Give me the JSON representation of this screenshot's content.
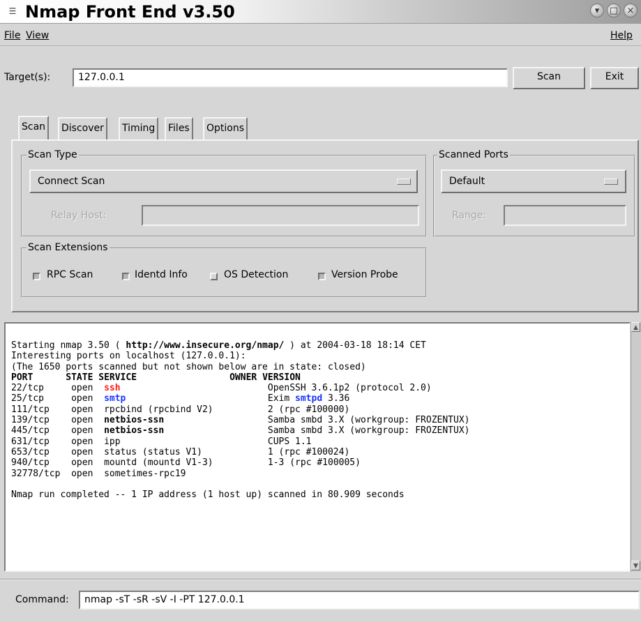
{
  "window": {
    "title": "Nmap Front End v3.50",
    "icon": "window-menu-icon",
    "controls": [
      "minimize-icon",
      "maximize-icon",
      "close-icon"
    ]
  },
  "menubar": {
    "file": "File",
    "view": "View",
    "help": "Help"
  },
  "target": {
    "label": "Target(s):",
    "value": "127.0.0.1",
    "scan_button": "Scan",
    "exit_button": "Exit"
  },
  "tabs": [
    "Scan",
    "Discover",
    "Timing",
    "Files",
    "Options"
  ],
  "active_tab": "Scan",
  "scan_type": {
    "title": "Scan Type",
    "selected": "Connect Scan",
    "relay_label": "Relay Host:",
    "relay_value": ""
  },
  "scanned_ports": {
    "title": "Scanned Ports",
    "selected": "Default",
    "range_label": "Range:",
    "range_value": ""
  },
  "scan_extensions": {
    "title": "Scan Extensions",
    "options": [
      {
        "label": "RPC Scan",
        "checked": true
      },
      {
        "label": "Identd Info",
        "checked": true
      },
      {
        "label": "OS Detection",
        "checked": false
      },
      {
        "label": "Version Probe",
        "checked": true
      }
    ]
  },
  "output": {
    "start_pre": "Starting nmap 3.50 ( ",
    "start_url": "http://www.insecure.org/nmap/",
    "start_post": " ) at 2004-03-18 18:14 CET",
    "interesting": "Interesting ports on localhost (127.0.0.1):",
    "not_shown": "(The 1650 ports scanned but not shown below are in state: closed)",
    "headers": {
      "port": "PORT",
      "state": "STATE",
      "service": "SERVICE",
      "owner": "OWNER",
      "version": "VERSION"
    },
    "rows": [
      {
        "port": "22/tcp",
        "state": "open",
        "service": "ssh",
        "service_style": "red",
        "version": "OpenSSH 3.6.1p2 (protocol 2.0)"
      },
      {
        "port": "25/tcp",
        "state": "open",
        "service": "smtp",
        "service_style": "blue",
        "version_pre": "Exim ",
        "version_highlight": "smtpd",
        "version_post": " 3.36"
      },
      {
        "port": "111/tcp",
        "state": "open",
        "service": "rpcbind (rpcbind V2)",
        "service_style": "normal",
        "version": "2 (rpc #100000)"
      },
      {
        "port": "139/tcp",
        "state": "open",
        "service": "netbios-ssn",
        "service_style": "bold",
        "version": "Samba smbd 3.X (workgroup: FROZENTUX)"
      },
      {
        "port": "445/tcp",
        "state": "open",
        "service": "netbios-ssn",
        "service_style": "bold",
        "version": "Samba smbd 3.X (workgroup: FROZENTUX)"
      },
      {
        "port": "631/tcp",
        "state": "open",
        "service": "ipp",
        "service_style": "normal",
        "version": "CUPS 1.1"
      },
      {
        "port": "653/tcp",
        "state": "open",
        "service": "status (status V1)",
        "service_style": "normal",
        "version": "1 (rpc #100024)"
      },
      {
        "port": "940/tcp",
        "state": "open",
        "service": "mountd (mountd V1-3)",
        "service_style": "normal",
        "version": "1-3 (rpc #100005)"
      },
      {
        "port": "32778/tcp",
        "state": "open",
        "service": "sometimes-rpc19",
        "service_style": "normal",
        "version": ""
      }
    ],
    "completed": "Nmap run completed -- 1 IP address (1 host up) scanned in 80.909 seconds"
  },
  "command": {
    "label": "Command:",
    "value": "nmap -sT -sR -sV -I -PT 127.0.0.1"
  },
  "colors": {
    "ssh": "#ff1b1b",
    "smtp": "#1733ff",
    "background": "#d6d6d6"
  }
}
